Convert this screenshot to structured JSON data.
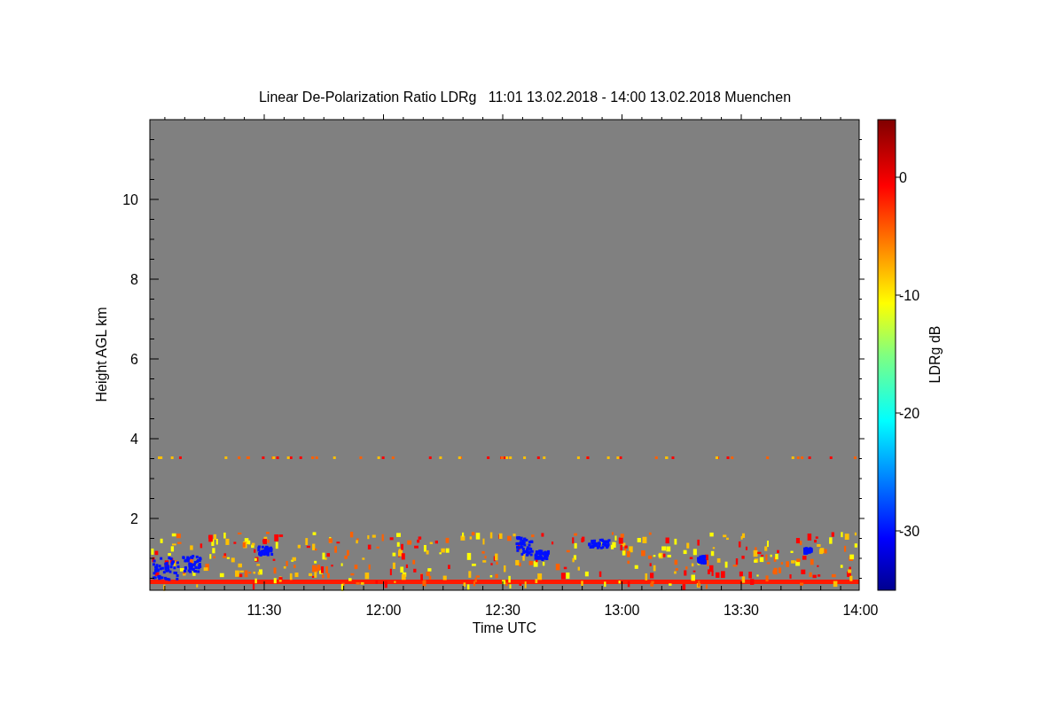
{
  "title": "Linear De-Polarization Ratio LDRg   11:01 13.02.2018 - 14:00 13.02.2018 Muenchen",
  "plot": {
    "ylabel": "Height AGL km",
    "xlabel": "Time UTC",
    "yticks": [
      "10",
      "8",
      "6",
      "4",
      "2"
    ],
    "xticks": [
      "11:30",
      "12:00",
      "12:30",
      "13:00",
      "13:30",
      "14:00"
    ]
  },
  "colorbar": {
    "label": "LDRg dB",
    "ticks": [
      "0",
      "-10",
      "-20",
      "-30"
    ]
  }
}
